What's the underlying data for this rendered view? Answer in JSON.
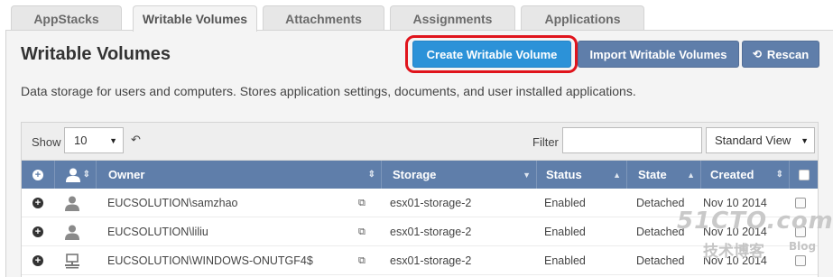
{
  "tabs": [
    {
      "label": "AppStacks",
      "active": false
    },
    {
      "label": "Writable Volumes",
      "active": true
    },
    {
      "label": "Attachments",
      "active": false
    },
    {
      "label": "Assignments",
      "active": false
    },
    {
      "label": "Applications",
      "active": false
    }
  ],
  "header": {
    "title": "Writable Volumes",
    "description": "Data storage for users and computers. Stores application settings, documents, and user installed applications."
  },
  "toolbar": {
    "create_label": "Create Writable Volume",
    "import_label": "Import Writable Volumes",
    "rescan_label": "Rescan"
  },
  "table_controls": {
    "show_label": "Show",
    "page_size": "10",
    "filter_label": "Filter",
    "filter_value": "",
    "view_selected": "Standard View"
  },
  "columns": {
    "owner": "Owner",
    "storage": "Storage",
    "status": "Status",
    "state": "State",
    "created": "Created"
  },
  "rows": [
    {
      "type_icon": "user-icon",
      "owner": "EUCSOLUTION\\samzhao",
      "storage": "esx01-storage-2",
      "status": "Enabled",
      "state": "Detached",
      "created": "Nov 10 2014"
    },
    {
      "type_icon": "user-icon",
      "owner": "EUCSOLUTION\\liliu",
      "storage": "esx01-storage-2",
      "status": "Enabled",
      "state": "Detached",
      "created": "Nov 10 2014"
    },
    {
      "type_icon": "computer-icon",
      "owner": "EUCSOLUTION\\WINDOWS-ONUTGF4$",
      "storage": "esx01-storage-2",
      "status": "Enabled",
      "state": "Detached",
      "created": "Nov 10 2014"
    }
  ],
  "watermark": {
    "main": "51CTO.com",
    "sub": "技术博客",
    "blog": "Blog"
  },
  "colors": {
    "create_button": "#2c92d8",
    "secondary_button": "#5f7eaa",
    "highlight_ring": "#e0141c",
    "table_header": "#5f7eaa"
  }
}
